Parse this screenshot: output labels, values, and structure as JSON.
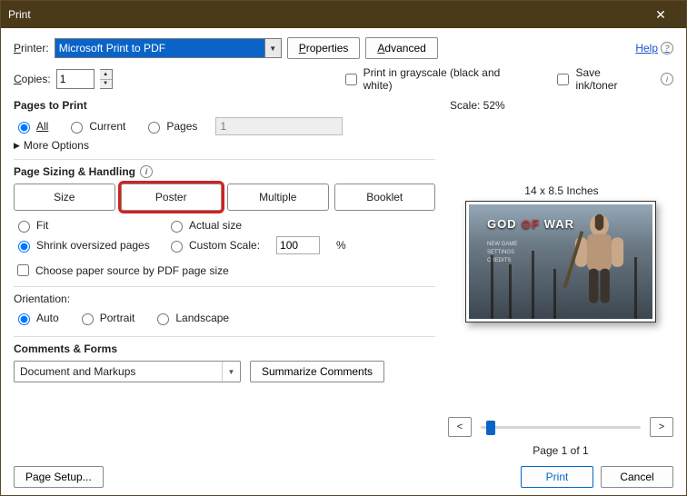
{
  "window": {
    "title": "Print"
  },
  "top": {
    "printer_label": "Printer:",
    "printer_value": "Microsoft Print to PDF",
    "properties_btn": "Properties",
    "advanced_btn": "Advanced",
    "help": "Help"
  },
  "copies": {
    "label": "Copies:",
    "value": "1",
    "grayscale": "Print in grayscale (black and white)",
    "saveink": "Save ink/toner"
  },
  "pages": {
    "title": "Pages to Print",
    "all": "All",
    "current": "Current",
    "pages": "Pages",
    "pages_value": "1",
    "more": "More Options"
  },
  "sizing": {
    "title": "Page Sizing & Handling",
    "tabs": {
      "size": "Size",
      "poster": "Poster",
      "multiple": "Multiple",
      "booklet": "Booklet"
    },
    "fit": "Fit",
    "actual": "Actual size",
    "shrink": "Shrink oversized pages",
    "custom": "Custom Scale:",
    "custom_value": "100",
    "pct": "%",
    "choose_source": "Choose paper source by PDF page size"
  },
  "orientation": {
    "title": "Orientation:",
    "auto": "Auto",
    "portrait": "Portrait",
    "landscape": "Landscape"
  },
  "comments": {
    "title": "Comments & Forms",
    "value": "Document and Markups",
    "summarize": "Summarize Comments"
  },
  "preview": {
    "scale": "Scale:  52%",
    "dims": "14 x 8.5 Inches",
    "game_title_1": "GOD",
    "game_title_2": "WAR",
    "page_indicator": "Page 1 of 1"
  },
  "footer": {
    "page_setup": "Page Setup...",
    "print": "Print",
    "cancel": "Cancel"
  }
}
